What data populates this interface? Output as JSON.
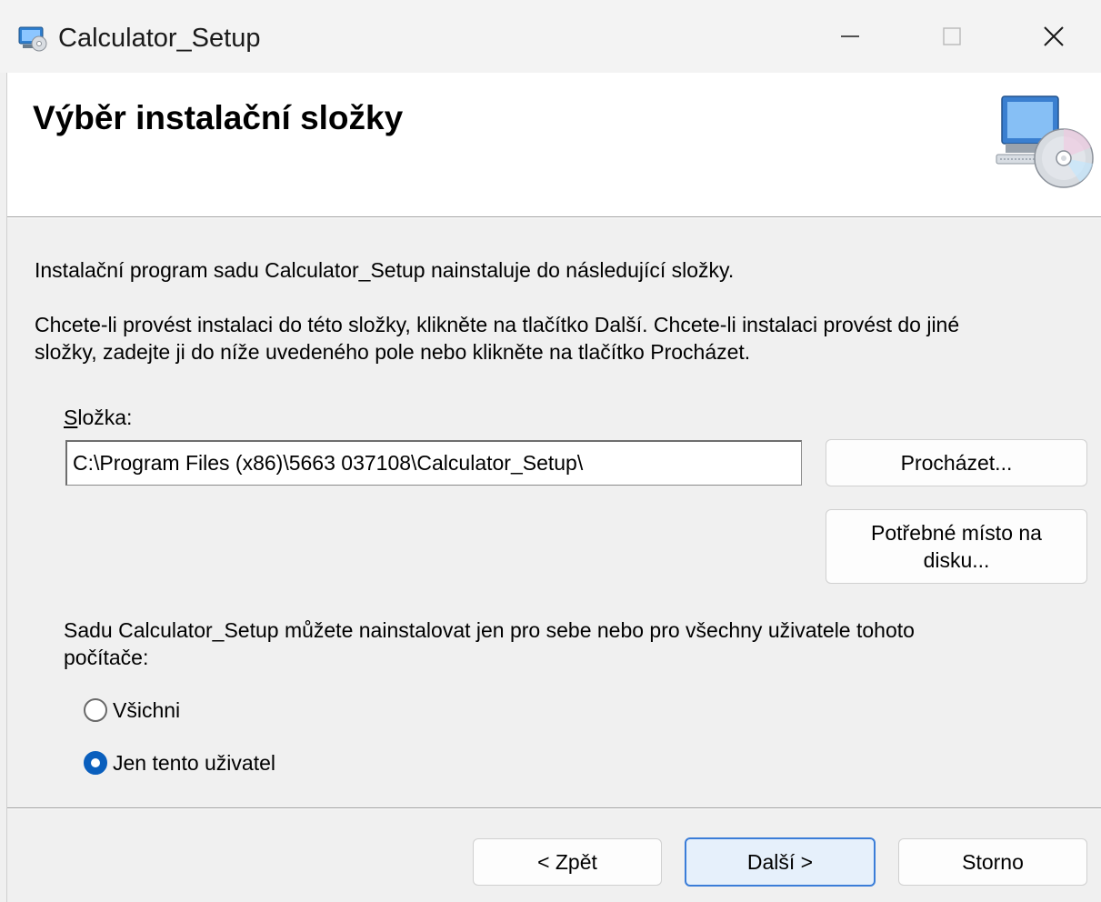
{
  "window": {
    "title": "Calculator_Setup",
    "minimize_icon": "minimize-icon",
    "maximize_icon": "maximize-icon",
    "close_icon": "close-icon"
  },
  "header": {
    "title": "Výběr instalační složky",
    "icon": "computer-cd-icon"
  },
  "body": {
    "intro": "Instalační program sadu Calculator_Setup nainstaluje do následující složky.",
    "instructions_line1": "Chcete-li provést instalaci do této složky, klikněte na tlačítko Další. Chcete-li instalaci provést do jiné",
    "instructions_line2": "složky, zadejte ji do níže uvedeného pole nebo klikněte na tlačítko Procházet.",
    "folder_label_first": "S",
    "folder_label_rest": "ložka:",
    "folder_value": "C:\\Program Files (x86)\\5663 037108\\Calculator_Setup\\",
    "browse_button": "Procházet...",
    "disk_space_button_line1": "Potřebné místo na",
    "disk_space_button_line2": "disku...",
    "scope_text_line1": "Sadu Calculator_Setup můžete nainstalovat jen pro sebe nebo pro všechny uživatele tohoto",
    "scope_text_line2": "počítače:",
    "radio_all": "Všichni",
    "radio_only_me": "Jen tento uživatel",
    "selected_option": "Jen tento uživatel"
  },
  "footer": {
    "back_button": "< Zpět",
    "next_button": "Další >",
    "cancel_button": "Storno"
  },
  "colors": {
    "accent": "#0a5fbd",
    "primary_button_border": "#3b7dd8",
    "window_background": "#f0f0f0",
    "header_background": "#ffffff"
  }
}
